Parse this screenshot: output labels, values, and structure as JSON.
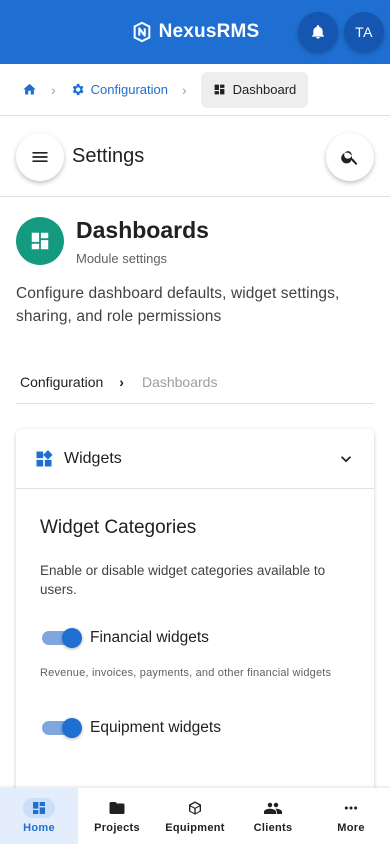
{
  "app": {
    "brand": "NexusRMS",
    "avatar_initials": "TA"
  },
  "icons": {
    "brand": "nexus-logo-icon",
    "notifications": "bell-icon",
    "home": "home-icon",
    "configuration": "gear-icon",
    "dashboard": "dashboard-icon",
    "menu": "hamburger-menu-icon",
    "search": "search-icon",
    "widgets": "widgets-icon",
    "expand": "chevron-down-icon"
  },
  "breadcrumb": {
    "config_label": "Configuration",
    "current_label": "Dashboard"
  },
  "settings": {
    "title": "Settings"
  },
  "module": {
    "title": "Dashboards",
    "subtitle": "Module settings",
    "description": "Configure dashboard defaults, widget settings, sharing, and role permissions"
  },
  "sub_breadcrumb": {
    "first": "Configuration",
    "last": "Dashboards"
  },
  "widgets_panel": {
    "title": "Widgets",
    "section_title": "Widget Categories",
    "section_description": "Enable or disable widget categories available to users.",
    "toggles": [
      {
        "label": "Financial widgets",
        "help": "Revenue, invoices, payments, and other financial widgets",
        "enabled": true
      },
      {
        "label": "Equipment widgets",
        "enabled": true
      }
    ]
  },
  "bottom_nav": {
    "items": [
      {
        "label": "Home",
        "icon": "home-dashboard-icon",
        "active": true
      },
      {
        "label": "Projects",
        "icon": "folder-icon",
        "active": false
      },
      {
        "label": "Equipment",
        "icon": "box-icon",
        "active": false
      },
      {
        "label": "Clients",
        "icon": "people-icon",
        "active": false
      },
      {
        "label": "More",
        "icon": "more-dots-icon",
        "active": false
      }
    ]
  },
  "colors": {
    "primary": "#1e6fd1",
    "module_accent": "#149a7f"
  }
}
